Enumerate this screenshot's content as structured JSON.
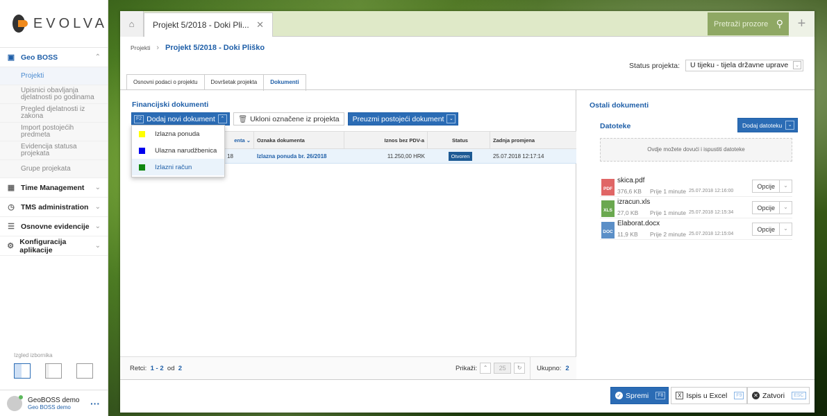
{
  "brand": {
    "name": "EVOLVA"
  },
  "sidebar": {
    "active_module": "Geo BOSS",
    "sub_items": [
      "Projekti",
      "Upisnici obavljanja djelatnosti po godinama",
      "Pregled djelatnosti iz zakona",
      "Import postojećih predmeta",
      "Evidencija statusa projekata",
      "Grupe projekata"
    ],
    "modules": [
      "Time Management",
      "TMS administration",
      "Osnovne evidencije",
      "Konfiguracija aplikacije"
    ],
    "izgled_label": "Izgled izbornika",
    "user_name": "GeoBOSS demo",
    "user_org": "Geo BOSS demo"
  },
  "window": {
    "tab_title": "Projekt 5/2018 - Doki Pli...",
    "search_placeholder": "Pretraži prozore"
  },
  "breadcrumb": {
    "root": "Projekti",
    "current": "Projekt 5/2018 - Doki Plišk o"
  },
  "status": {
    "label": "Status projekta:",
    "value": "U tijeku - tijela državne uprave"
  },
  "tabs": [
    "Osnovni podaci o projektu",
    "Dovršetak projekta",
    "Dokumenti"
  ],
  "financijski": {
    "title": "Financijski dokumenti",
    "add_kbd": "F2",
    "add_label": "Dodaj novi dokument",
    "remove_label": "Ukloni označene iz projekta",
    "fetch_label": "Preuzmi postojeći dokument",
    "columns": [
      "enta",
      "Oznaka dokumenta",
      "Iznos bez PDV-a",
      "Status",
      "Zadnja promjena"
    ],
    "row": {
      "col1": "18",
      "oznaka": "Izlazna ponuda br. 26/2018",
      "iznos": "11.250,00 HRK",
      "status": "Otvoren",
      "datum": "25.07.2018 12:17:14"
    },
    "dropdown": [
      {
        "label": "Izlazna ponuda",
        "color": "#ffff00"
      },
      {
        "label": "Ulazna narudžbenica",
        "color": "#0000ee"
      },
      {
        "label": "Izlazni račun",
        "color": "#118811"
      }
    ]
  },
  "pager": {
    "retci": "Retci:",
    "from": "1",
    "to": "2",
    "od": "od",
    "total": "2",
    "prikazi": "Prikaži:",
    "page_size": "25",
    "ukupno": "Ukupno:",
    "ukupno_val": "2"
  },
  "ostali": {
    "title": "Ostali dokumenti",
    "datoteke": "Datoteke",
    "add_file": "Dodaj datoteku",
    "dropzone": "Ovdje možete dovući i ispustiti datoteke",
    "files": [
      {
        "type": "PDF",
        "color": "#e06666",
        "name": "skica.pdf",
        "size": "376,6 KB",
        "ago": "Prije 1 minute",
        "date": "25.07.2018 12:16:00"
      },
      {
        "type": "XLS",
        "color": "#6aa84f",
        "name": "izracun.xls",
        "size": "27,0 KB",
        "ago": "Prije 1 minute",
        "date": "25.07.2018 12:15:34"
      },
      {
        "type": "DOC",
        "color": "#5b8fc7",
        "name": "Elaborat.docx",
        "size": "11,9 KB",
        "ago": "Prije 2 minute",
        "date": "25.07.2018 12:15:04"
      }
    ],
    "opcije": "Opcije"
  },
  "footer": {
    "save": "Spremi",
    "save_kbd": "F8",
    "excel": "Ispis u Excel",
    "excel_kbd": "F9",
    "close": "Zatvori",
    "close_kbd": "ESC"
  }
}
